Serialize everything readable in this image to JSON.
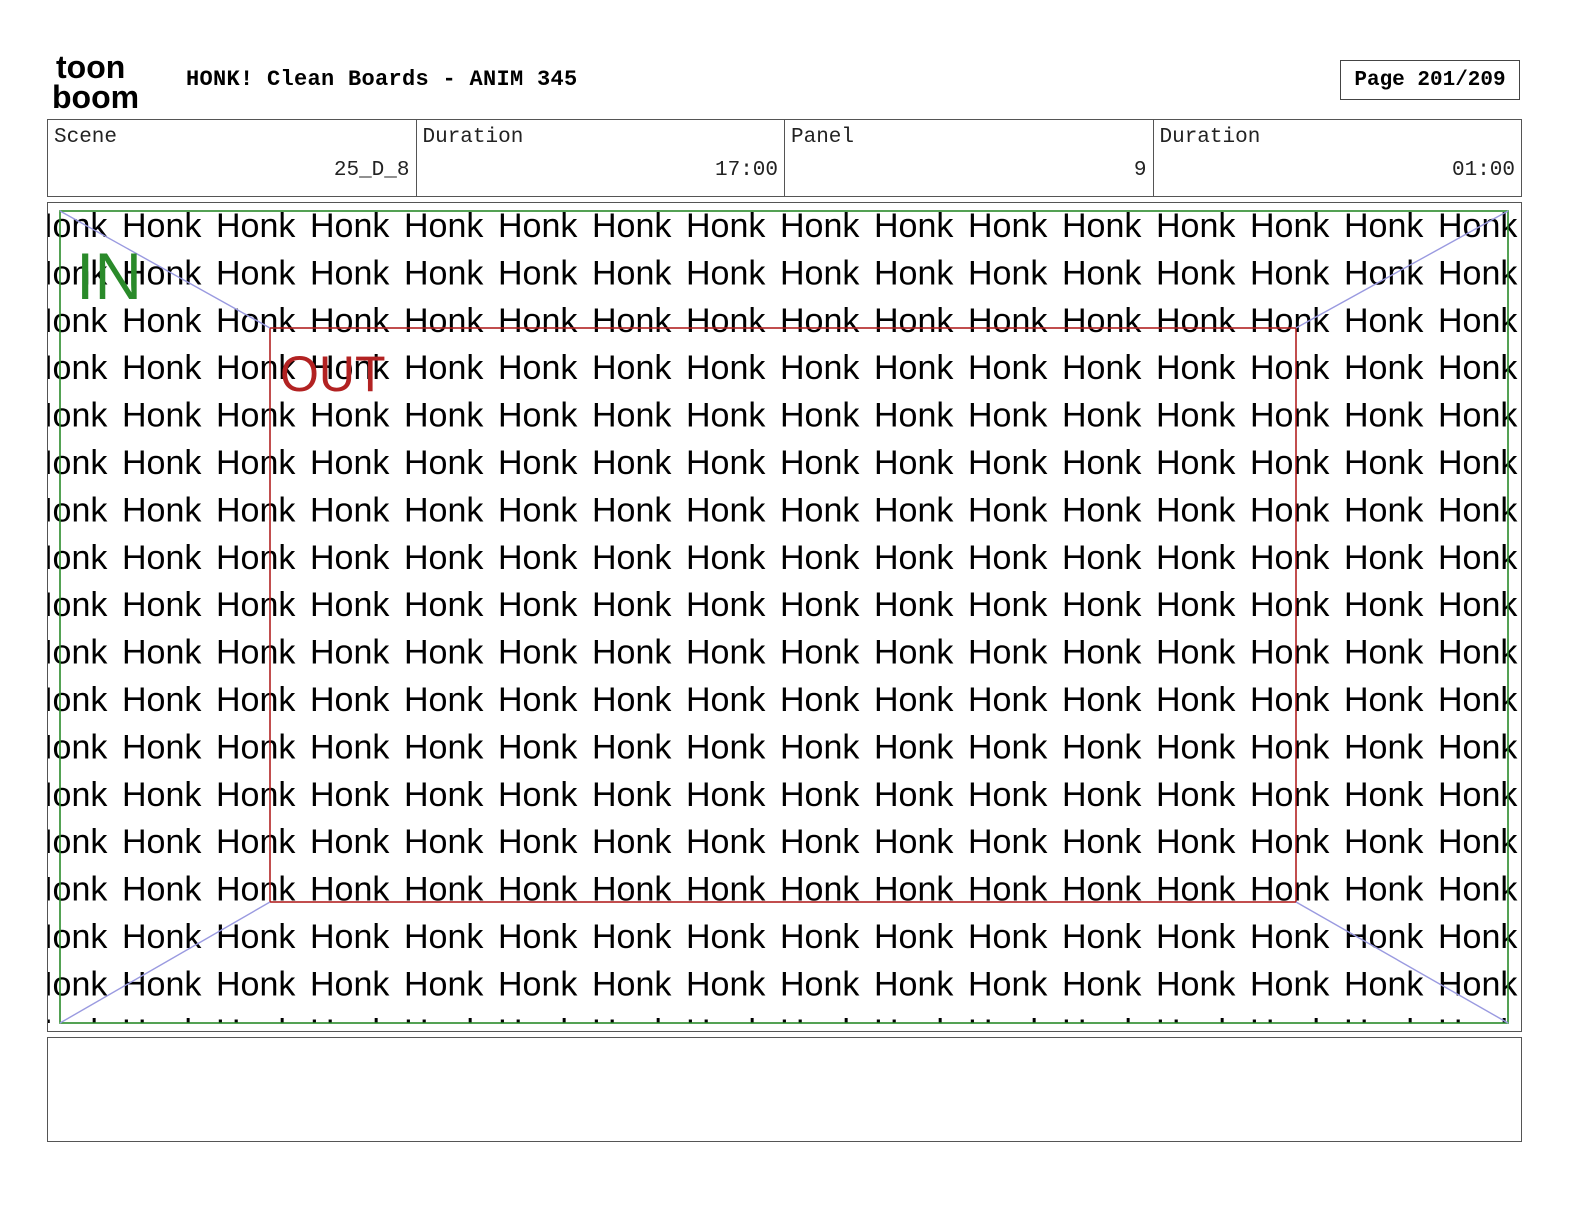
{
  "header": {
    "logo_text_top": "toon",
    "logo_text_bottom": "boom",
    "title": "HONK! Clean Boards - ANIM 345",
    "page_indicator": "Page 201/209"
  },
  "info": {
    "scene_label": "Scene",
    "scene_value": "25_D_8",
    "scene_duration_label": "Duration",
    "scene_duration_value": "17:00",
    "panel_label": "Panel",
    "panel_value": "9",
    "panel_duration_label": "Duration",
    "panel_duration_value": "01:00"
  },
  "panel": {
    "repeated_word": "Honk",
    "in_label": "IN",
    "out_label": "OUT",
    "colors": {
      "in_frame": "#2a8a2a",
      "out_frame": "#b22222",
      "camera_lines": "#9a9ae0",
      "text": "#000000"
    }
  },
  "notes": {
    "text": ""
  }
}
